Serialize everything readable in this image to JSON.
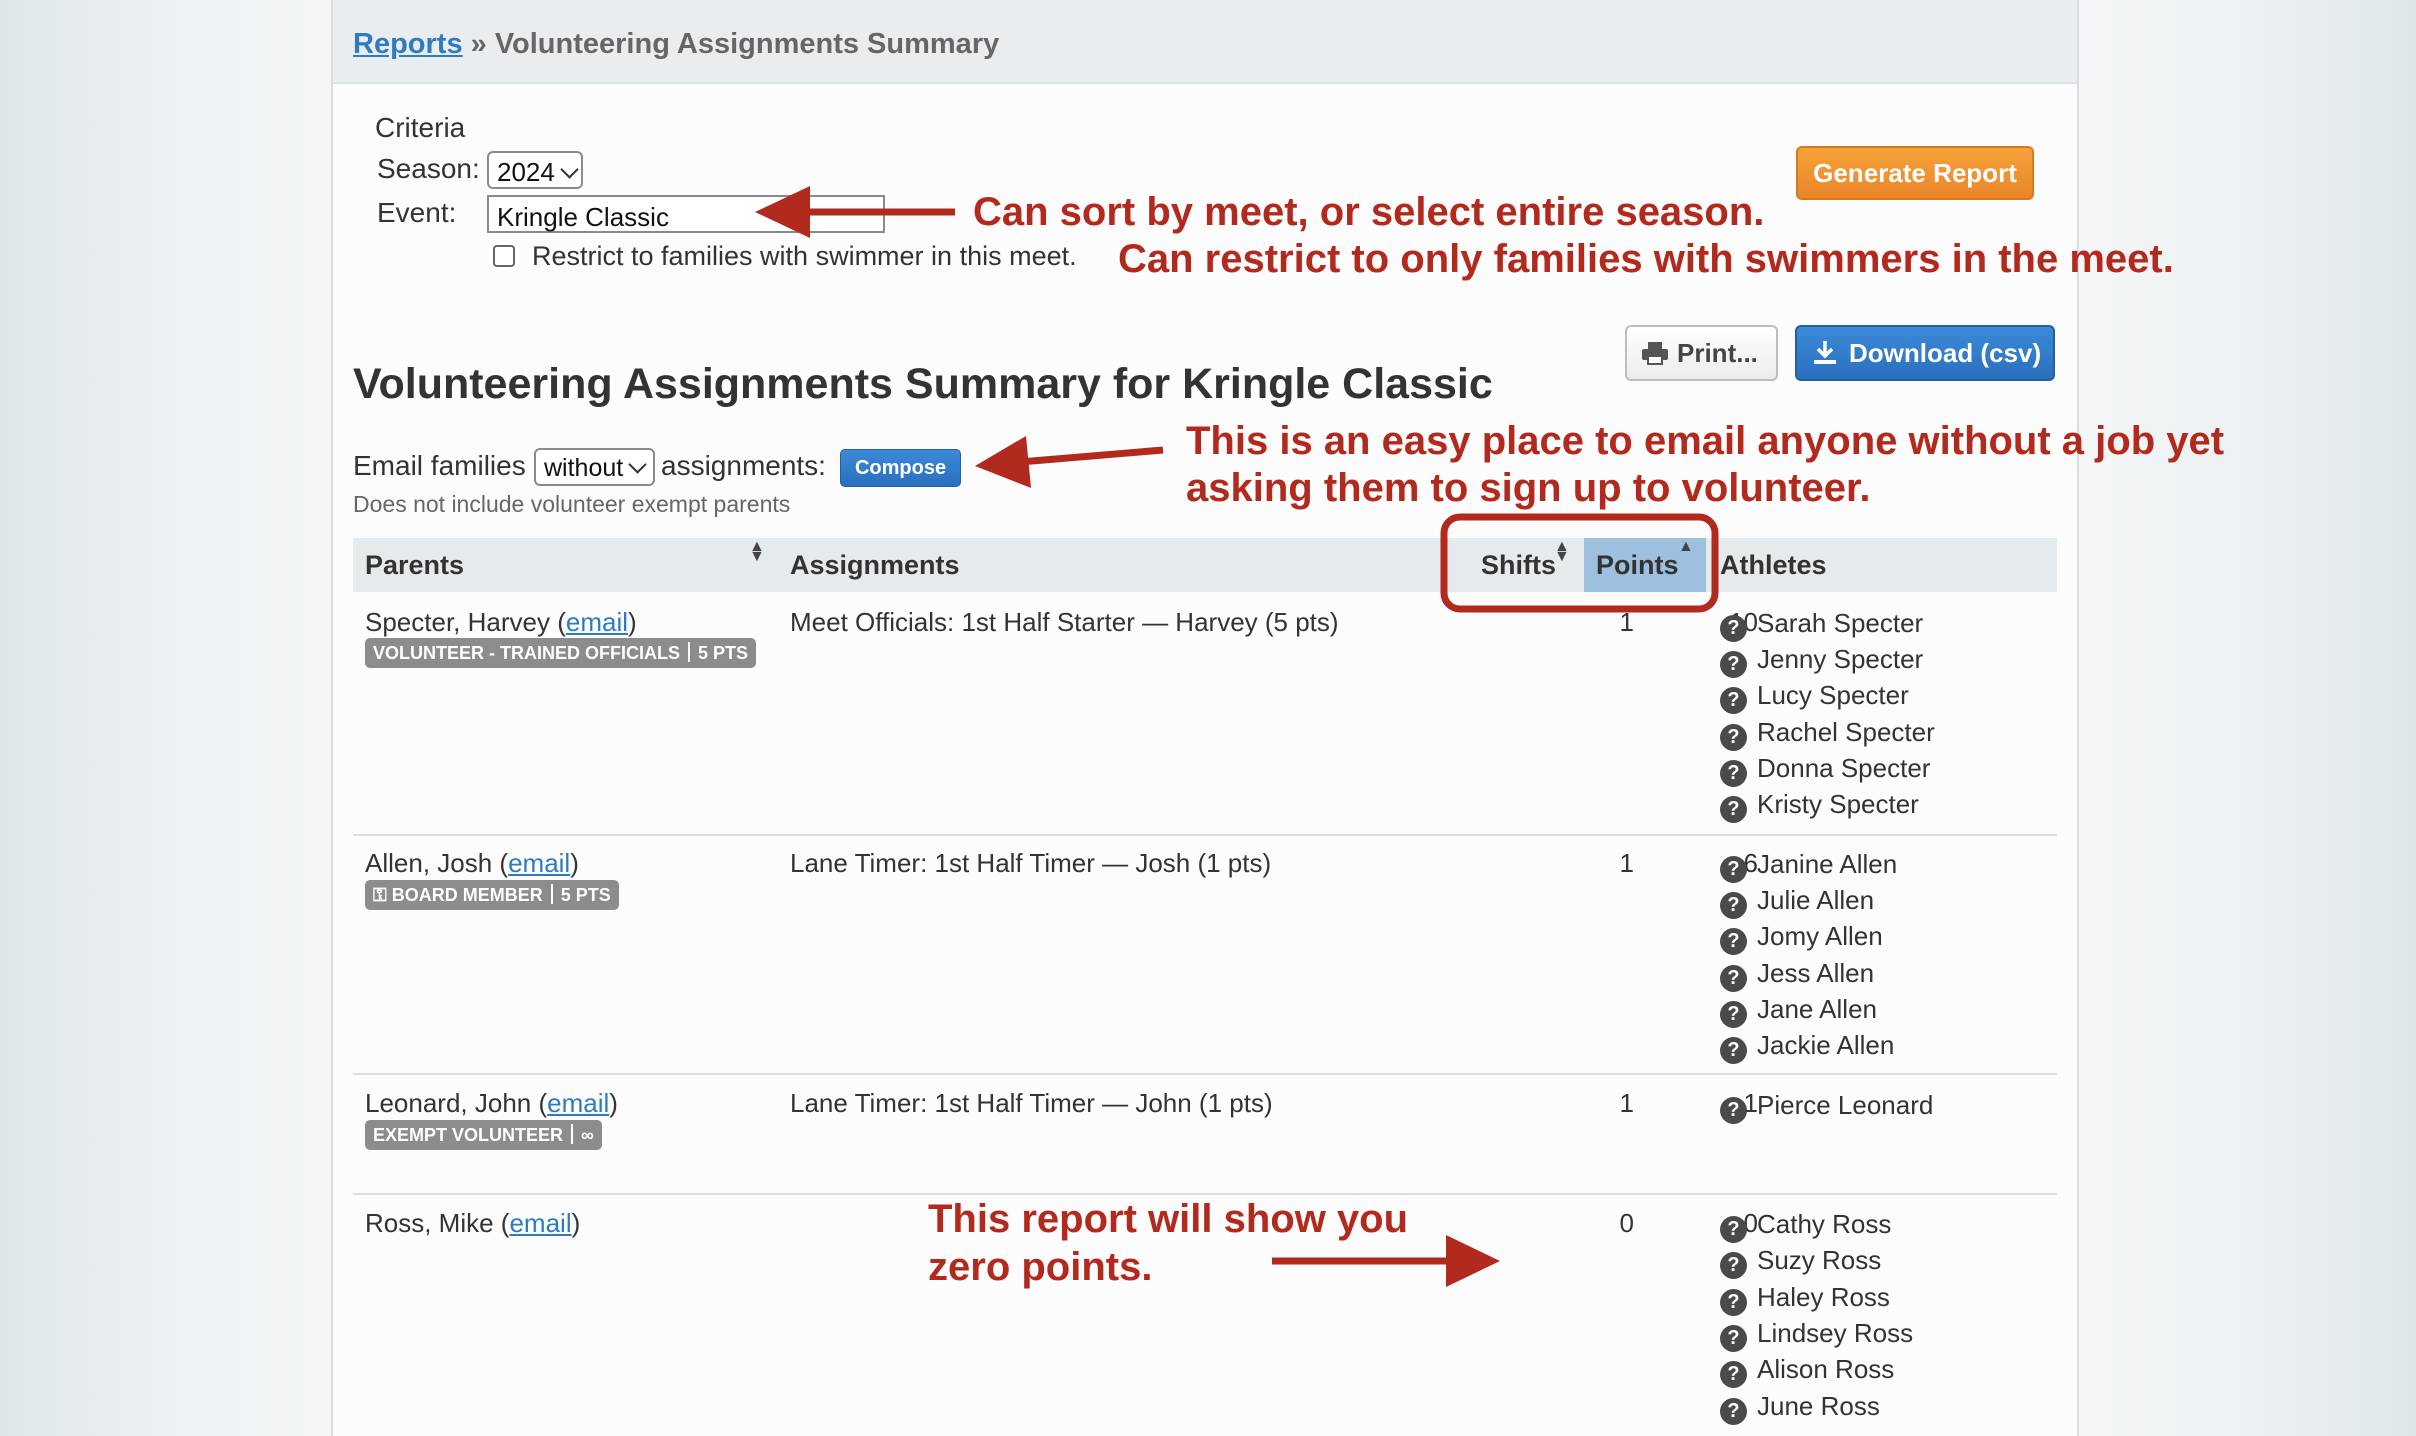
{
  "breadcrumb": {
    "link": "Reports",
    "separator": "»",
    "current": "Volunteering Assignments Summary"
  },
  "criteria": {
    "heading": "Criteria",
    "season_label": "Season:",
    "season_value": "2024",
    "event_label": "Event:",
    "event_value": "Kringle Classic",
    "restrict_label": "Restrict to families with swimmer in this meet.",
    "restrict_checked": false,
    "generate_button": "Generate Report"
  },
  "toolbar": {
    "print_label": "Print...",
    "download_label": "Download (csv)"
  },
  "report": {
    "title": "Volunteering Assignments Summary for Kringle Classic",
    "email_prefix": "Email families",
    "email_filter": "without",
    "email_suffix": "assignments:",
    "compose_label": "Compose",
    "note": "Does not include volunteer exempt parents"
  },
  "table": {
    "columns": {
      "parents": "Parents",
      "assignments": "Assignments",
      "shifts": "Shifts",
      "points": "Points",
      "athletes": "Athletes"
    },
    "rows": [
      {
        "parent": "Specter, Harvey",
        "email": "email",
        "badge": "VOLUNTEER - TRAINED OFFICIALS",
        "badge_value": "5 PTS",
        "assignment": "Meet Officials: 1st Half Starter — Harvey (5 pts)",
        "shifts": "1",
        "points": "10",
        "athletes": [
          "Sarah Specter",
          "Jenny Specter",
          "Lucy Specter",
          "Rachel Specter",
          "Donna Specter",
          "Kristy Specter"
        ]
      },
      {
        "parent": "Allen, Josh",
        "email": "email",
        "badge": "⚿ BOARD MEMBER",
        "badge_value": "5 PTS",
        "assignment": "Lane Timer: 1st Half Timer — Josh (1 pts)",
        "shifts": "1",
        "points": "6",
        "athletes": [
          "Janine Allen",
          "Julie Allen",
          "Jomy Allen",
          "Jess Allen",
          "Jane Allen",
          "Jackie Allen"
        ]
      },
      {
        "parent": "Leonard, John",
        "email": "email",
        "badge": "EXEMPT VOLUNTEER",
        "badge_value": "∞",
        "assignment": "Lane Timer: 1st Half Timer — John (1 pts)",
        "shifts": "1",
        "points": "1",
        "athletes": [
          "Pierce Leonard"
        ]
      },
      {
        "parent": "Ross, Mike",
        "email": "email",
        "assignment": "",
        "shifts": "0",
        "points": "0",
        "athletes": [
          "Cathy Ross",
          "Suzy Ross",
          "Haley Ross",
          "Lindsey Ross",
          "Alison Ross",
          "June Ross"
        ]
      }
    ]
  },
  "annotations": {
    "sort": "Can sort by meet, or select entire season.",
    "restrict": "Can restrict to only families with swimmers in the meet.",
    "email_line1": "This is an easy place to email anyone without a job yet",
    "email_line2": "asking them to sign up to volunteer.",
    "zero_line1": "This report will show you",
    "zero_line2": "zero points."
  },
  "colors": {
    "annotation": "#b22a1e",
    "accent_blue": "#2a70bd",
    "accent_orange": "#e9862a",
    "sorted_header": "#9dc0de"
  },
  "icons": [
    "printer-icon",
    "download-icon",
    "sort-icon",
    "help-icon",
    "chevron-down-icon",
    "key-icon"
  ]
}
